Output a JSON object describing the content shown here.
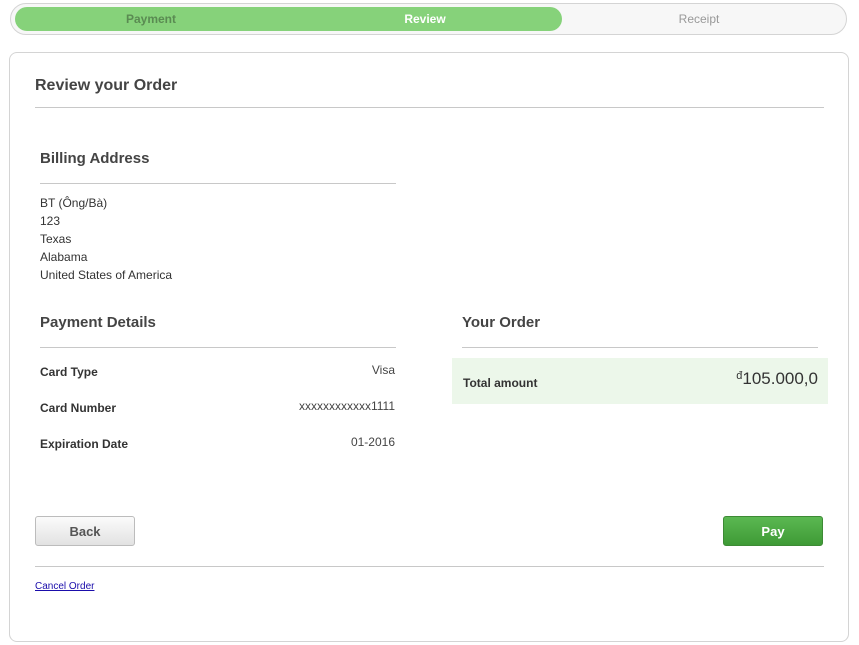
{
  "progress": {
    "steps": [
      "Payment",
      "Review",
      "Receipt"
    ]
  },
  "page": {
    "title": "Review your Order"
  },
  "billing": {
    "title": "Billing Address",
    "lines": [
      "BT (Ông/Bà)",
      "123",
      "Texas",
      "Alabama",
      "United States of America"
    ]
  },
  "payment_details": {
    "title": "Payment Details",
    "rows": [
      {
        "label": "Card Type",
        "value": "Visa"
      },
      {
        "label": "Card Number",
        "value": "xxxxxxxxxxxx1111"
      },
      {
        "label": "Expiration Date",
        "value": "01-2016"
      }
    ]
  },
  "order": {
    "title": "Your Order",
    "total_label": "Total amount",
    "currency_symbol": "đ",
    "total_value": "105.000,0"
  },
  "actions": {
    "back_label": "Back",
    "pay_label": "Pay",
    "cancel_label": "Cancel Order"
  },
  "colors": {
    "progress_active": "#86d27a",
    "pay_button": "#4aa842",
    "total_bg": "#ecf7ea"
  }
}
